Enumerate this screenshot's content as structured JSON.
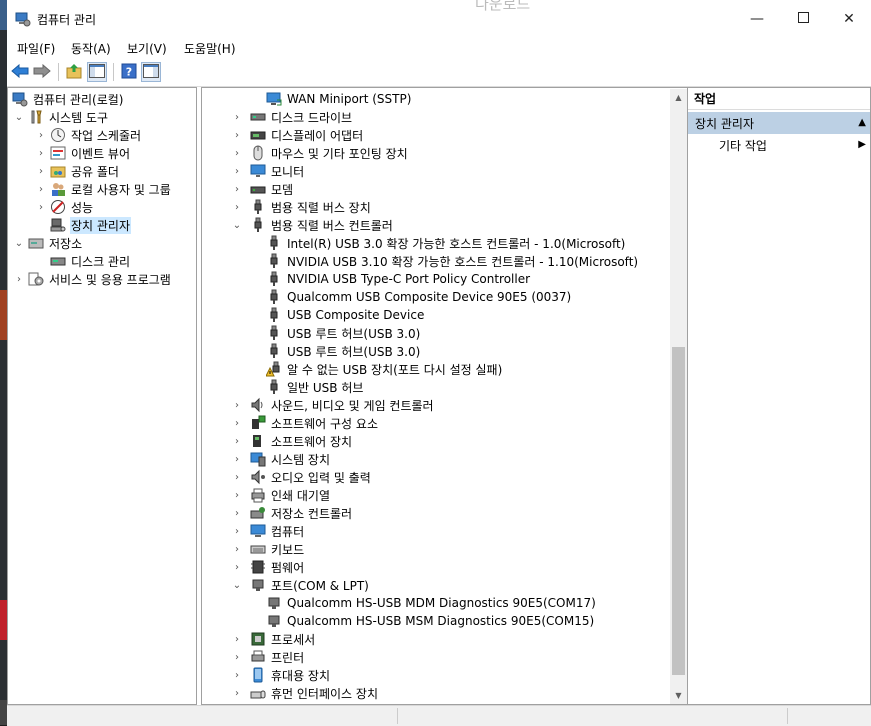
{
  "window": {
    "title": "컴퓨터 관리",
    "background_hint": "다운로드"
  },
  "menu": [
    "파일(F)",
    "동작(A)",
    "보기(V)",
    "도움말(H)"
  ],
  "toolbar": [
    "back-icon",
    "forward-icon",
    "up-folder-icon",
    "show-hide-tree-icon",
    "help-icon",
    "properties-icon"
  ],
  "nav_tree": [
    {
      "label": "컴퓨터 관리(로컬)",
      "icon": "computer-management-icon"
    },
    {
      "label": "시스템 도구",
      "icon": "system-tools-icon"
    },
    {
      "label": "작업 스케줄러",
      "icon": "task-scheduler-icon"
    },
    {
      "label": "이벤트 뷰어",
      "icon": "event-viewer-icon"
    },
    {
      "label": "공유 폴더",
      "icon": "shared-folders-icon"
    },
    {
      "label": "로컬 사용자 및 그룹",
      "icon": "local-users-icon"
    },
    {
      "label": "성능",
      "icon": "performance-icon"
    },
    {
      "label": "장치 관리자",
      "icon": "device-manager-icon"
    },
    {
      "label": "저장소",
      "icon": "storage-icon"
    },
    {
      "label": "디스크 관리",
      "icon": "disk-management-icon"
    },
    {
      "label": "서비스 및 응용 프로그램",
      "icon": "services-icon"
    }
  ],
  "device_tree": [
    {
      "label": "WAN Miniport (SSTP)",
      "icon": "network-adapter-icon"
    },
    {
      "label": "디스크 드라이브",
      "icon": "disk-drive-icon"
    },
    {
      "label": "디스플레이 어댑터",
      "icon": "display-adapter-icon"
    },
    {
      "label": "마우스 및 기타 포인팅 장치",
      "icon": "mouse-icon"
    },
    {
      "label": "모니터",
      "icon": "monitor-icon"
    },
    {
      "label": "모뎀",
      "icon": "modem-icon"
    },
    {
      "label": "범용 직렬 버스 장치",
      "icon": "usb-plug-icon"
    },
    {
      "label": "범용 직렬 버스 컨트롤러",
      "icon": "usb-plug-icon"
    },
    {
      "label": "Intel(R) USB 3.0 확장 가능한 호스트 컨트롤러 - 1.0(Microsoft)",
      "icon": "usb-plug-icon"
    },
    {
      "label": "NVIDIA USB 3.10 확장 가능한 호스트 컨트롤러 - 1.10(Microsoft)",
      "icon": "usb-plug-icon"
    },
    {
      "label": "NVIDIA USB Type-C Port Policy Controller",
      "icon": "usb-plug-icon"
    },
    {
      "label": "Qualcomm USB Composite Device 90E5 (0037)",
      "icon": "usb-plug-icon"
    },
    {
      "label": "USB Composite Device",
      "icon": "usb-plug-icon"
    },
    {
      "label": "USB 루트 허브(USB 3.0)",
      "icon": "usb-plug-icon"
    },
    {
      "label": "USB 루트 허브(USB 3.0)",
      "icon": "usb-plug-icon"
    },
    {
      "label": "알 수 없는 USB 장치(포트 다시 설정 실패)",
      "icon": "usb-warning-icon"
    },
    {
      "label": "일반 USB 허브",
      "icon": "usb-plug-icon"
    },
    {
      "label": "사운드, 비디오 및 게임 컨트롤러",
      "icon": "speaker-icon"
    },
    {
      "label": "소프트웨어 구성 요소",
      "icon": "software-component-icon"
    },
    {
      "label": "소프트웨어 장치",
      "icon": "software-device-icon"
    },
    {
      "label": "시스템 장치",
      "icon": "system-device-icon"
    },
    {
      "label": "오디오 입력 및 출력",
      "icon": "audio-io-icon"
    },
    {
      "label": "인쇄 대기열",
      "icon": "print-queue-icon"
    },
    {
      "label": "저장소 컨트롤러",
      "icon": "storage-controller-icon"
    },
    {
      "label": "컴퓨터",
      "icon": "computer-icon"
    },
    {
      "label": "키보드",
      "icon": "keyboard-icon"
    },
    {
      "label": "펌웨어",
      "icon": "firmware-icon"
    },
    {
      "label": "포트(COM & LPT)",
      "icon": "port-icon"
    },
    {
      "label": "Qualcomm HS-USB MDM Diagnostics 90E5(COM17)",
      "icon": "port-icon"
    },
    {
      "label": "Qualcomm HS-USB MSM Diagnostics 90E5(COM15)",
      "icon": "port-icon"
    },
    {
      "label": "프로세서",
      "icon": "processor-icon"
    },
    {
      "label": "프린터",
      "icon": "printer-icon"
    },
    {
      "label": "휴대용 장치",
      "icon": "portable-device-icon"
    },
    {
      "label": "휴먼 인터페이스 장치",
      "icon": "hid-icon"
    }
  ],
  "actions": {
    "header": "작업",
    "section": "장치 관리자",
    "sub": "기타 작업"
  }
}
